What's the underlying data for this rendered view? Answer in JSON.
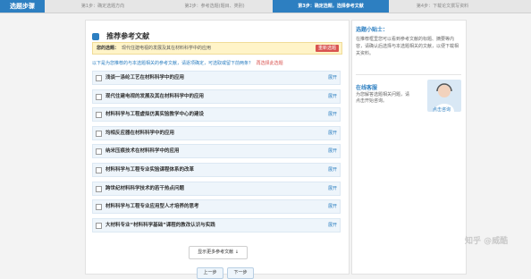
{
  "steps": {
    "brand": "选题步骤",
    "items": [
      "第1步：确定选题方向",
      "第2步：参考选题(题目、类别)",
      "第3步：确定选题，选择参考文献",
      "第4步：下载论文撰写资料"
    ],
    "active_index": 2
  },
  "main": {
    "title": "推荐参考文献",
    "selected_label": "您的选题：",
    "selected_value": "现代住建电视的发展及其在材料科学中的应用",
    "reselect_button": "重新选题",
    "hint": "以下是为您推荐的与本选题相关的参考文献，请逐项确定，可选取或留下前两条？",
    "hint_link": "再选择此选题"
  },
  "references": [
    {
      "title": "浅谈一涤纶工艺在材料科学中的应用",
      "action": "展开"
    },
    {
      "title": "现代住建电视的发展及其在材料科学中的应用",
      "action": "展开"
    },
    {
      "title": "材料科学与工程虚拟仿真实验教学中心的建设",
      "action": "展开"
    },
    {
      "title": "均相反应器在材料科学中的应用",
      "action": "展开"
    },
    {
      "title": "纳米压痕技术在材料科学中的应用",
      "action": "展开"
    },
    {
      "title": "材料科学与工程专业实验课程体系的改革",
      "action": "展开"
    },
    {
      "title": "跨世纪材料科学技术的若干热点问题",
      "action": "展开"
    },
    {
      "title": "材料科学与工程专业应用型人才培养的思考",
      "action": "展开"
    },
    {
      "title": "大材料专业“材料科学基础”课程的教改认识与实践",
      "action": "展开"
    }
  ],
  "more_button": "显示更多参考文献",
  "nav": {
    "prev": "上一步",
    "next": "下一步"
  },
  "side": {
    "title": "选题小贴士：",
    "body": "在推荐框里您可以看到参考文献的标题、摘要等内容，请确认后选择与本选题相关的文献，以便下载相关资料。",
    "online_title": "在线客服",
    "online_body": "为您解答选题相关问题，请点击开始咨询。",
    "avatar_link": "点击咨询"
  },
  "watermark": "知乎 @威酷"
}
